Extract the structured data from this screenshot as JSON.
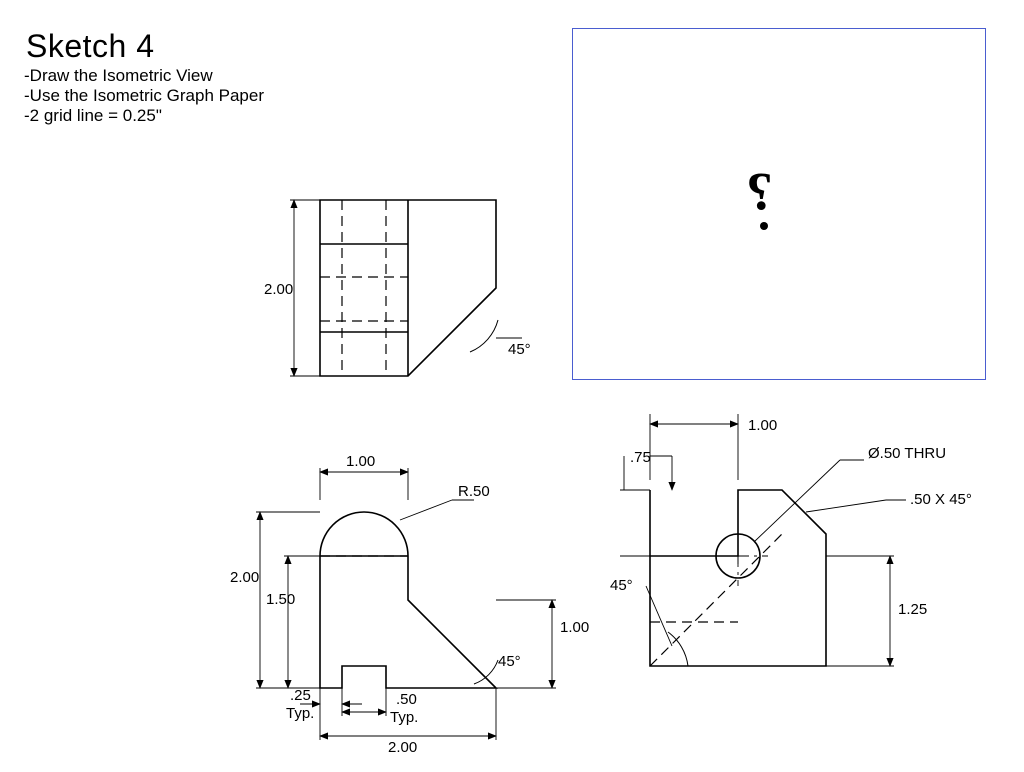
{
  "header": {
    "title": "Sketch 4",
    "instructions": [
      "-Draw the Isometric View",
      "-Use the Isometric Graph Paper",
      "-2 grid line = 0.25\""
    ]
  },
  "placeholder": {
    "symbol": "?"
  },
  "dims": {
    "top_height": "2.00",
    "top_angle": "45°",
    "front_width_top": "1.00",
    "front_radius": "R.50",
    "front_height": "2.00",
    "front_shelf": "1.50",
    "front_step": "1.00",
    "front_angle": "45°",
    "front_gap25": ".25",
    "front_typ1": "Typ.",
    "front_gap50": ".50",
    "front_typ2": "Typ.",
    "front_width_bot": "2.00",
    "right_notch_w": "1.00",
    "right_notch_h": ".75",
    "right_hole": "Ø.50 THRU",
    "right_chamfer": ".50 X 45°",
    "right_angle": "45°",
    "right_125": "1.25"
  },
  "chart_data": {
    "type": "diagram",
    "title": "Sketch 4 – Orthographic views for isometric construction",
    "grid_scale": "2 grid lines = 0.25 in",
    "views": [
      {
        "name": "top",
        "width": 2.0,
        "depth": 2.0,
        "features": [
          {
            "type": "chamfer",
            "angle_deg": 45,
            "face": "front-right edge"
          },
          {
            "type": "hidden",
            "note": "slot and hole projections"
          }
        ]
      },
      {
        "name": "front",
        "width": 2.0,
        "height": 2.0,
        "features": [
          {
            "type": "arc",
            "radius": 0.5,
            "span_deg": 180,
            "location": "top of left boss, boss width 1.00"
          },
          {
            "type": "step",
            "height": 1.5,
            "note": "shelf drops to 1.00 at right"
          },
          {
            "type": "chamfer",
            "angle_deg": 45,
            "face": "lower-right, rises to 1.00"
          },
          {
            "type": "slot",
            "x_gap_left": 0.25,
            "width": 0.5,
            "note": "square notch at bottom (Typ.)"
          }
        ]
      },
      {
        "name": "right",
        "width": 2.0,
        "height": 2.0,
        "features": [
          {
            "type": "notch",
            "width": 1.0,
            "depth": 0.75,
            "location": "top-left"
          },
          {
            "type": "hole",
            "diameter": 0.5,
            "thru": true,
            "center_from_bottom": 1.25
          },
          {
            "type": "chamfer",
            "size": 0.5,
            "angle_deg": 45,
            "face": "top-right"
          },
          {
            "type": "diagonal",
            "angle_deg": 45,
            "from": "lower-left",
            "to": "upper-right region"
          }
        ]
      },
      {
        "name": "isometric",
        "status": "to be drawn (placeholder box with ? )"
      }
    ]
  }
}
